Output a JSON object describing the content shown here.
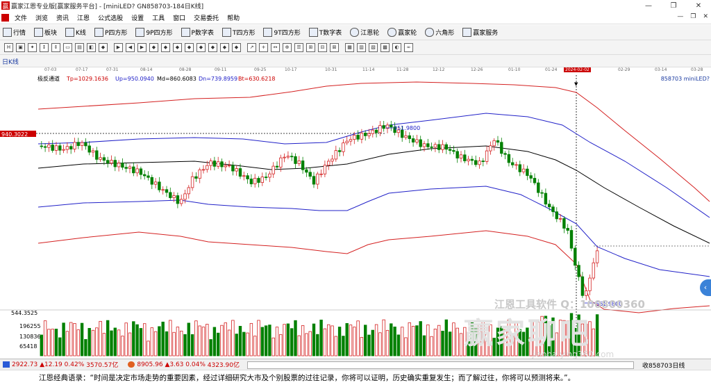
{
  "window": {
    "title": "赢家江恩专业版[赢家服务平台] - [miniLED? GN858703-184日K线]",
    "minimize": "—",
    "restore": "❐",
    "close": "✕"
  },
  "menu": {
    "items": [
      "文件",
      "浏览",
      "资讯",
      "江恩",
      "公式选股",
      "设置",
      "工具",
      "窗口",
      "交易委托",
      "帮助"
    ],
    "right": [
      "—",
      "❐",
      "✕"
    ]
  },
  "toolbar1": {
    "items": [
      "行情",
      "板块",
      "K线",
      "P四方形",
      "9P四方形",
      "P数字表",
      "T四方形",
      "9T四方形",
      "T数字表",
      "江恩轮",
      "赢家轮",
      "六角形",
      "赢家服务"
    ]
  },
  "chart": {
    "period_label": "日K线",
    "indicator_name": "极反通道",
    "params": {
      "tp": "Tp=1029.1636",
      "up": "Up=950.0940",
      "md": "Md=860.6083",
      "dn": "Dn=739.8959",
      "bt": "Bt=630.6218"
    },
    "code_label": "858703 miniLED?",
    "left_price_mark": "940.3022",
    "max_label": "951.9800",
    "min_label": "561.9800",
    "cursor_date": "2024-02-02",
    "dates": [
      "07-03",
      "07-17",
      "07-31",
      "08-14",
      "08-28",
      "09-11",
      "09-25",
      "10-17",
      "10-31",
      "11-14",
      "11-28",
      "12-12",
      "12-26",
      "01-10",
      "01-24",
      "2024-02-02",
      "02-29",
      "03-14",
      "03-28"
    ],
    "vol_ticks": [
      "544.3525",
      "196255",
      "130836",
      "65418"
    ]
  },
  "status": {
    "sh_index": "2922.73",
    "sh_chg": "▲12.19",
    "sh_pct": "0.42%",
    "sh_amt": "3570.57亿",
    "sz_index": "8905.96",
    "sz_chg": "▲3.63",
    "sz_pct": "0.04%",
    "sz_amt": "4323.90亿",
    "right_text": "收858703日线"
  },
  "quote": {
    "label": "江恩经典语录：",
    "text": "“时间是决定市场走势的重要因素，经过详细研究大市及个别股票的过往记录，你将可以证明，历史确实重复发生；而了解过往，你将可以预测将来。”。"
  },
  "watermark": {
    "line1": "江恩工具软件  Q：100800360",
    "line2": "赢家聊吧",
    "line3": "jiaoba.ying360.com"
  },
  "colors": {
    "outer_channel": "#d42020",
    "inner_channel": "#2020c8",
    "mid_line": "#000000",
    "up_candle": "#d42020",
    "down_candle": "#008000"
  }
}
